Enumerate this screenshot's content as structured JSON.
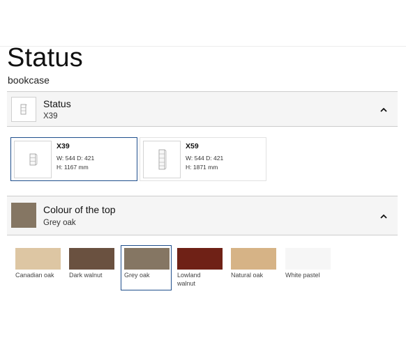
{
  "page": {
    "title": "Status",
    "subtitle": "bookcase"
  },
  "status_section": {
    "title": "Status",
    "value": "X39",
    "icon": "bookcase-thumbnail-icon",
    "chevron": "chevron-up-icon",
    "options": [
      {
        "name": "X39",
        "dims_line1": "W: 544 D: 421",
        "dims_line2": "H: 1167 mm",
        "selected": true
      },
      {
        "name": "X59",
        "dims_line1": "W: 544 D: 421",
        "dims_line2": "H: 1871 mm",
        "selected": false
      }
    ]
  },
  "colour_section": {
    "title": "Colour of the top",
    "value": "Grey oak",
    "swatch_color": "#857663",
    "chevron": "chevron-up-icon",
    "options": [
      {
        "label": "Canadian oak",
        "color": "#ddc6a3",
        "selected": false
      },
      {
        "label": "Dark walnut",
        "color": "#6a5140",
        "selected": false
      },
      {
        "label": "Grey oak",
        "color": "#857663",
        "selected": true
      },
      {
        "label": "Lowland walnut",
        "color": "#6f2116",
        "selected": false
      },
      {
        "label": "Natural oak",
        "color": "#d6b386",
        "selected": false
      },
      {
        "label": "White pastel",
        "color": "#f6f6f6",
        "selected": false
      }
    ]
  },
  "colors": {
    "selected_border": "#1f4e8c",
    "header_bg": "#f5f5f5"
  }
}
